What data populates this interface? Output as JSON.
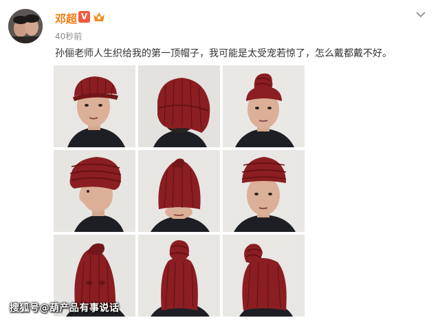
{
  "post": {
    "username": "邓超",
    "verified_label": "V",
    "timestamp": "40秒前",
    "text": "孙俪老师人生织给我的第一顶帽子，我可能是太受宠若惊了，怎么戴都戴不好。"
  },
  "icons": {
    "verified": "verified-v-badge",
    "member": "crown-badge",
    "menu": "chevron-down-icon"
  },
  "photos": [
    {
      "label": "photo-1",
      "pose": "hat-on-forehead"
    },
    {
      "label": "photo-2",
      "pose": "back-of-head"
    },
    {
      "label": "photo-3",
      "pose": "front-knot-top"
    },
    {
      "label": "photo-4",
      "pose": "side-profile"
    },
    {
      "label": "photo-5",
      "pose": "hat-over-eyes"
    },
    {
      "label": "photo-6",
      "pose": "front-face"
    },
    {
      "label": "photo-7",
      "pose": "hat-over-face"
    },
    {
      "label": "photo-8",
      "pose": "hat-over-face-knot"
    },
    {
      "label": "photo-9",
      "pose": "hat-over-face-side"
    }
  ],
  "watermark": "搜狐号@葫产品有事说话",
  "colors": {
    "username": "#f07a0a",
    "hat": "#8b1e22",
    "text": "#333333",
    "timestamp": "#8c8c8c"
  }
}
